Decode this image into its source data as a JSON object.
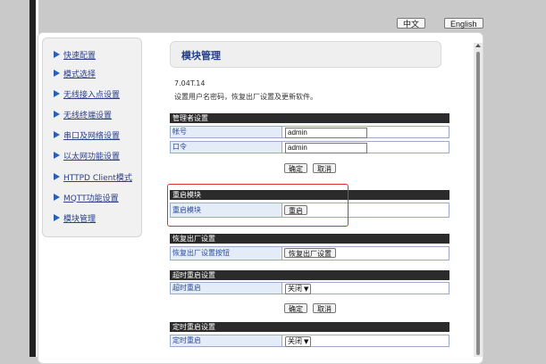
{
  "lang": {
    "zh": "中文",
    "en": "English"
  },
  "sidebar": {
    "items": [
      {
        "label": "快速配置"
      },
      {
        "label": "模式选择"
      },
      {
        "label": "无线接入点设置"
      },
      {
        "label": "无线终端设置"
      },
      {
        "label": "串口及网络设置"
      },
      {
        "label": "以太网功能设置"
      },
      {
        "label": "HTTPD Client模式"
      },
      {
        "label": "MQTT功能设置"
      },
      {
        "label": "模块管理"
      }
    ]
  },
  "main": {
    "title": "模块管理",
    "version": "7.04T.14",
    "description": "设置用户名密码，恢复出厂设置及更新软件。"
  },
  "admin": {
    "header": "管理者设置",
    "account_label": "帐号",
    "account_value": "admin",
    "password_label": "口令",
    "password_value": "admin",
    "ok": "确定",
    "cancel": "取消"
  },
  "restart": {
    "header": "重启模块",
    "label": "重启模块",
    "button": "重启"
  },
  "factory": {
    "header": "恢复出厂设置",
    "label": "恢复出厂设置按钮",
    "button": "恢复出厂设置"
  },
  "timeout_restart": {
    "header": "超时重启设置",
    "label": "超时重启",
    "value": "关闭",
    "ok": "确定",
    "cancel": "取消"
  },
  "timed_restart": {
    "header": "定时重启设置",
    "label": "定时重启",
    "value": "关闭"
  },
  "colors": {
    "section_header": "#2b2b2b",
    "row_label_bg": "#e4ecf7",
    "highlight": "#d63030",
    "nav_link": "#2b3f8a"
  }
}
